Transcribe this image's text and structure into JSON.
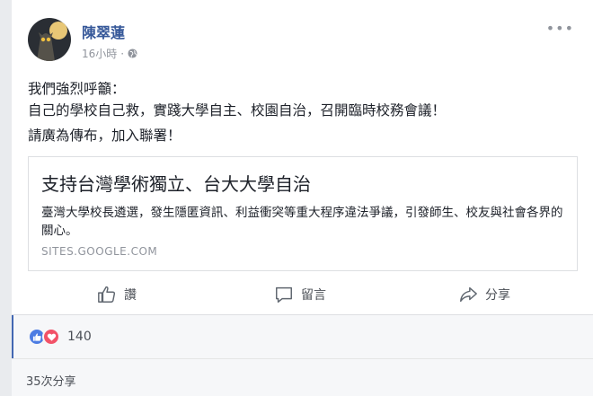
{
  "post": {
    "author": "陳翠蓮",
    "time": "16小時",
    "dot": "·",
    "more": "•••",
    "body": [
      "我們強烈呼籲：",
      "自己的學校自己救，實踐大學自主、校園自治，召開臨時校務會議！",
      "請廣為傳布，加入聯署！"
    ]
  },
  "link": {
    "title": "支持台灣學術獨立、台大大學自治",
    "description": "臺灣大學校長遴選，發生隱匿資訊、利益衝突等重大程序違法爭議，引發師生、校友與社會各界的關心。",
    "domain": "SITES.GOOGLE.COM"
  },
  "actions": {
    "like": "讚",
    "comment": "留言",
    "share": "分享"
  },
  "reactions": {
    "count": "140"
  },
  "shares": {
    "label": "35次分享"
  },
  "colors": {
    "author": "#365899",
    "like": "#4c7ce3",
    "love": "#f25268"
  }
}
